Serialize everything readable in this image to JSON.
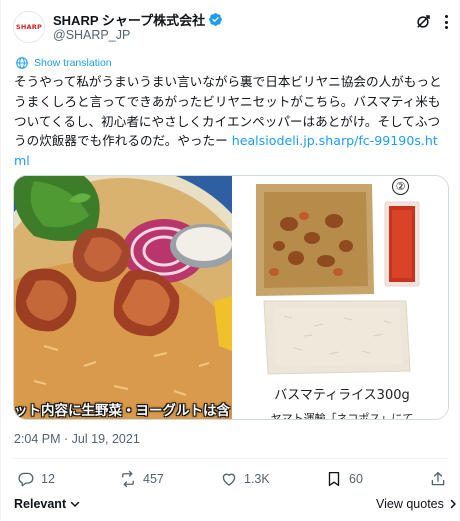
{
  "author": {
    "avatar_text": "SHARP",
    "display_name": "SHARP シャープ株式会社",
    "handle": "@SHARP_JP"
  },
  "translate": {
    "label": "Show translation"
  },
  "tweet": {
    "text": "そうやって私がうまいうまい言いながら裏で日本ビリヤニ協会の人がもっとうまくしろと言ってできあがったビリヤニセットがこちら。バスマティ米もついてくるし、初心者にやさしくカイエンペッパーはあとがけ。そしてふつうの炊飯器でも作れるのだ。やったー ",
    "link": "healsiodeli.jp.sharp/fc-99190s.html"
  },
  "media": {
    "left_caption": "ット内容に生野菜・ヨーグルトは含",
    "right_badge": "②",
    "right_label_1": "バスマティライス300g",
    "right_label_2": "ヤマト運輸「ネコポス」にて"
  },
  "timestamp": "2:04 PM · Jul 19, 2021",
  "actions": {
    "replies": "12",
    "retweets": "457",
    "likes": "1.3K",
    "bookmarks": "60"
  },
  "footer": {
    "sort_label": "Relevant",
    "quotes_label": "View quotes"
  },
  "colors": {
    "accent": "#1d9bf0",
    "secondary_text": "#536471",
    "brand_red": "#d31f26"
  },
  "icons": [
    "verified-icon",
    "grok-icon",
    "more-icon",
    "translate-icon",
    "reply-icon",
    "retweet-icon",
    "like-icon",
    "bookmark-icon",
    "share-icon",
    "chevron-down-icon",
    "chevron-right-icon"
  ]
}
